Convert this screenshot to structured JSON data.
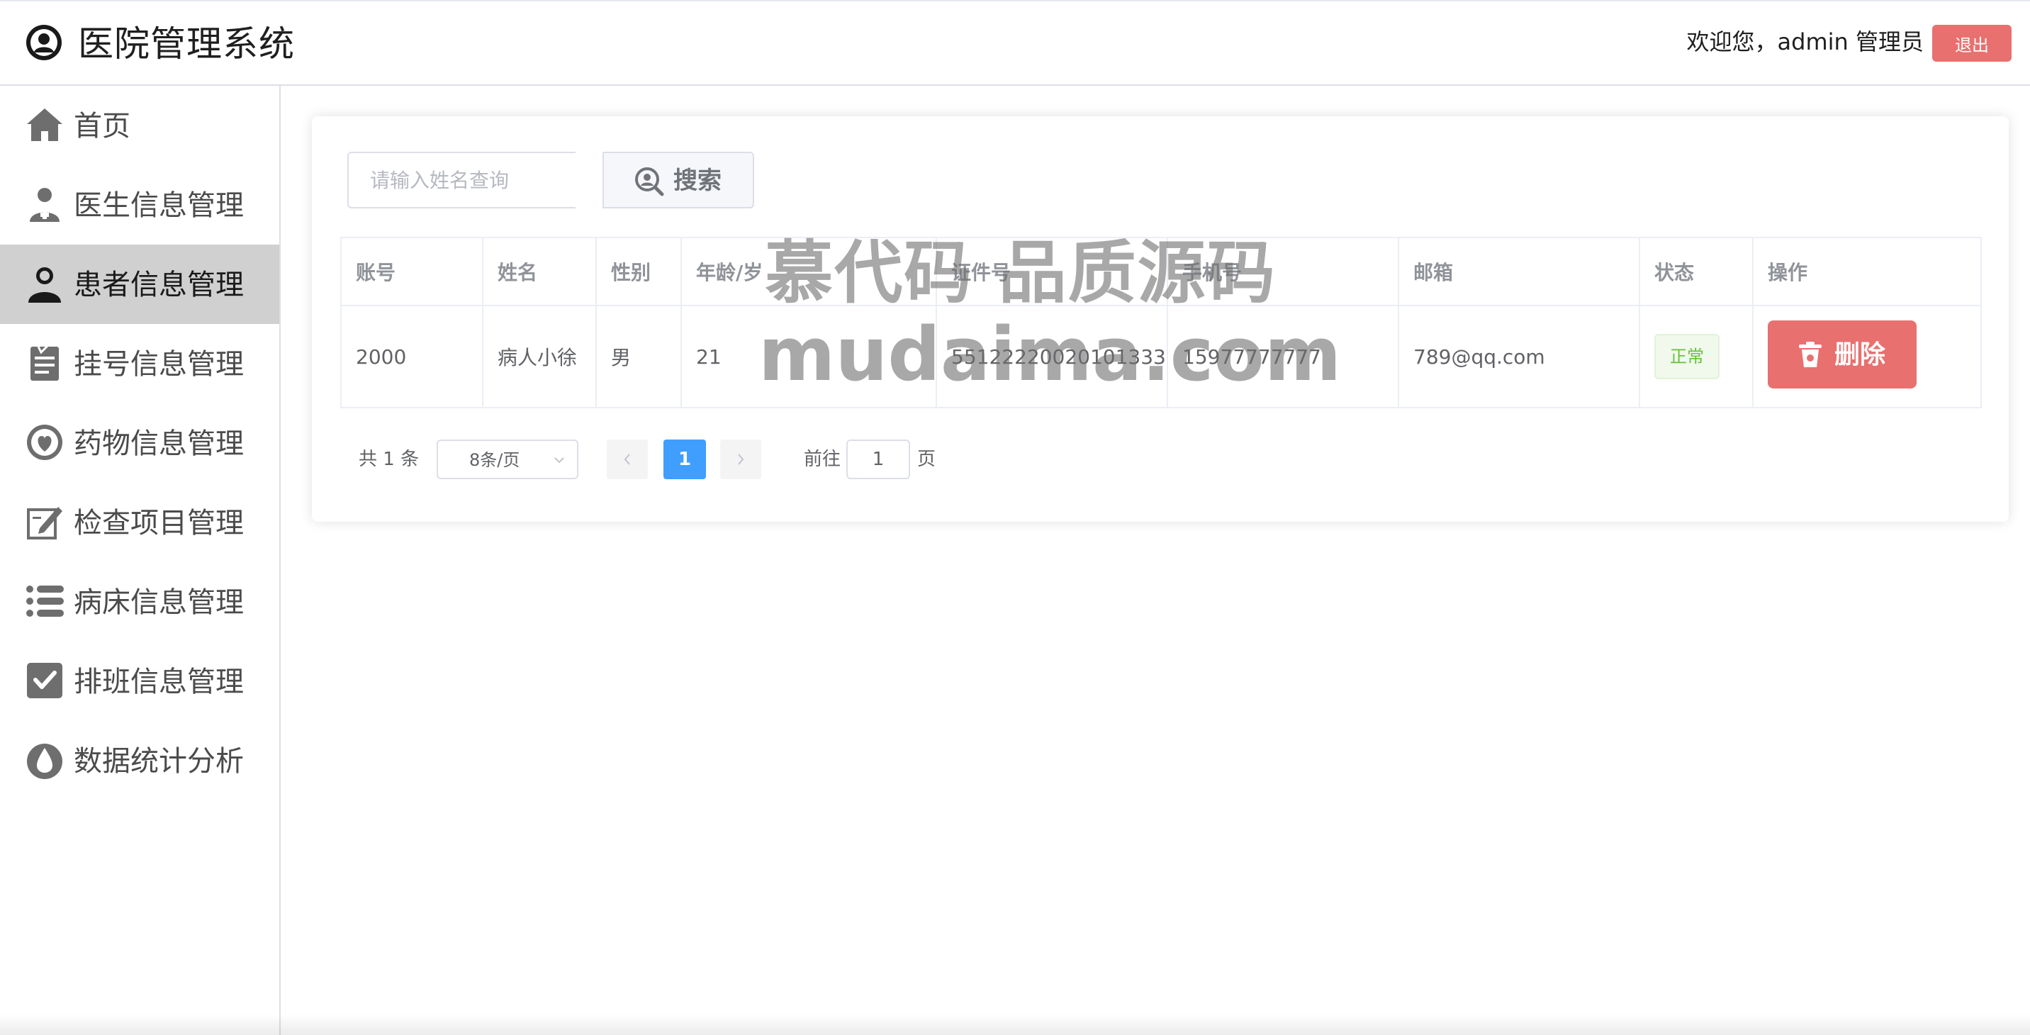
{
  "header": {
    "title": "医院管理系统",
    "welcome": "欢迎您，admin 管理员",
    "logout_label": "退出"
  },
  "sidebar": {
    "items": [
      {
        "label": "首页",
        "icon": "home-icon"
      },
      {
        "label": "医生信息管理",
        "icon": "doctor-icon"
      },
      {
        "label": "患者信息管理",
        "icon": "patient-icon",
        "active": true
      },
      {
        "label": "挂号信息管理",
        "icon": "clipboard-icon"
      },
      {
        "label": "药物信息管理",
        "icon": "medicine-icon"
      },
      {
        "label": "检查项目管理",
        "icon": "edit-icon"
      },
      {
        "label": "病床信息管理",
        "icon": "list-icon"
      },
      {
        "label": "排班信息管理",
        "icon": "checkbox-icon"
      },
      {
        "label": "数据统计分析",
        "icon": "drop-icon"
      }
    ]
  },
  "search": {
    "placeholder": "请输入姓名查询",
    "button_label": "搜索"
  },
  "table": {
    "headers": [
      "账号",
      "姓名",
      "性别",
      "年龄/岁",
      "证件号",
      "手机号",
      "邮箱",
      "状态",
      "操作"
    ],
    "rows": [
      {
        "account": "2000",
        "name": "病人小徐",
        "gender": "男",
        "age": "21",
        "id_number": "551222200201013333",
        "phone": "15977777777",
        "email": "789@qq.com",
        "status": "正常",
        "action": "删除"
      }
    ]
  },
  "pagination": {
    "total": "共 1 条",
    "page_size": "8条/页",
    "current_page": "1",
    "goto_label": "前往",
    "goto_value": "1",
    "goto_suffix": "页"
  },
  "watermark": {
    "line1": "慕代码 品质源码",
    "line2": "mudaima.com"
  },
  "colors": {
    "danger": "#e8706f",
    "primary": "#409eff",
    "success": "#67c23a",
    "active_nav": "#d0d0d0"
  }
}
